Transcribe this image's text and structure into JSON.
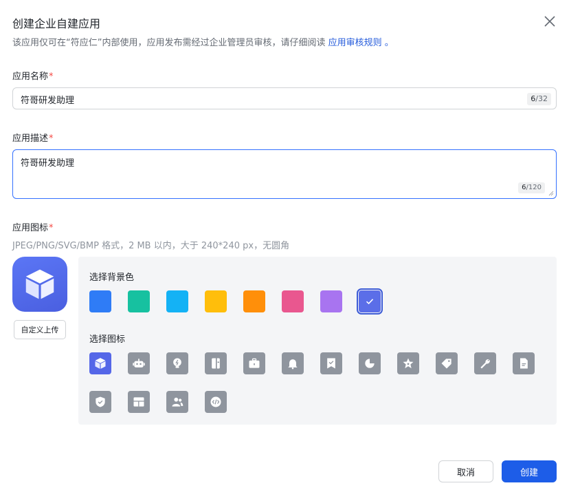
{
  "dialog": {
    "title": "创建企业自建应用",
    "subtitle_text": "该应用仅可在“符应仁”内部使用，应用发布需经过企业管理员审核，请仔细阅读 ",
    "subtitle_link": "应用审核规则",
    "subtitle_end": " 。",
    "close_icon": "close-icon"
  },
  "name_field": {
    "label": "应用名称",
    "required_mark": "*",
    "value": "符哥研发助理",
    "count": "6",
    "max": "/32"
  },
  "desc_field": {
    "label": "应用描述",
    "required_mark": "*",
    "value": "符哥研发助理",
    "count": "6",
    "max": "/120"
  },
  "icon_field": {
    "label": "应用图标",
    "required_mark": "*",
    "hint": "JPEG/PNG/SVG/BMP 格式，2 MB 以内，大于 240*240 px，无圆角",
    "upload_label": "自定义上传",
    "preview_icon": "cube-icon"
  },
  "bg_section": {
    "label": "选择背景色",
    "colors": [
      "#2f7cf6",
      "#17c1a0",
      "#14b2f5",
      "#ffbe0b",
      "#ff8f0a",
      "#e9578f",
      "#a874f0",
      "#5b6ee8"
    ],
    "selected_index": 7
  },
  "icon_section": {
    "label": "选择图标",
    "icons": [
      "cube-icon",
      "robot-icon",
      "lightbulb-icon",
      "book-icon",
      "briefcase-icon",
      "bell-icon",
      "bookmark-check-icon",
      "pie-chart-icon",
      "star-icon",
      "tag-icon",
      "wrench-icon",
      "document-icon",
      "shield-check-icon",
      "layout-icon",
      "users-icon",
      "code-icon"
    ],
    "selected_index": 0
  },
  "footer": {
    "cancel_label": "取消",
    "create_label": "创建"
  }
}
